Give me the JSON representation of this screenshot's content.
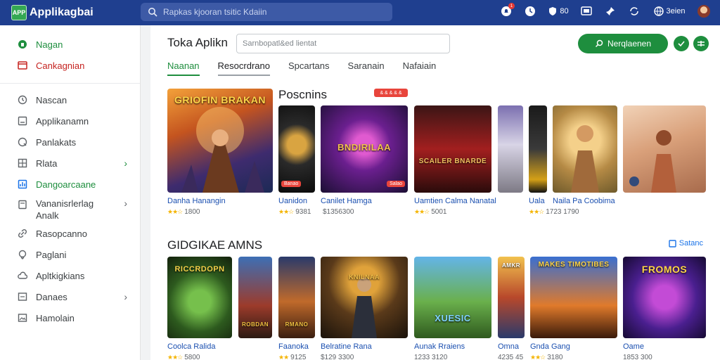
{
  "topbar": {
    "logo_mark": "APP",
    "app_name": "Applikagbai",
    "search_placeholder": "Rapkas kjooran tsitic Kdaiin",
    "notification_count": "1",
    "stat_label": "80",
    "user_label": "3eien",
    "icons": [
      "bell-icon",
      "clock-icon",
      "shield-icon",
      "cast-icon",
      "pin-icon",
      "sync-icon",
      "globe-icon"
    ]
  },
  "sidebar": {
    "top": [
      {
        "label": "Nagan",
        "icon": "home-icon",
        "state": "active"
      },
      {
        "label": "Cankagnian",
        "icon": "library-icon",
        "state": "highlight"
      }
    ],
    "items": [
      {
        "label": "Nascan",
        "icon": "clock-icon"
      },
      {
        "label": "Applikanamn",
        "icon": "app-icon"
      },
      {
        "label": "Panlakats",
        "icon": "search-icon"
      },
      {
        "label": "Rlata",
        "icon": "grid-icon",
        "chevron": "green"
      },
      {
        "label": "Dangoarcaane",
        "icon": "chart-icon",
        "state": "active"
      },
      {
        "label": "Vananisrlerlag Analk",
        "icon": "doc-icon",
        "chevron": "grey"
      },
      {
        "label": "Rasopcanno",
        "icon": "link-icon"
      },
      {
        "label": "Paglani",
        "icon": "pin-icon"
      },
      {
        "label": "Apltkigkians",
        "icon": "cloud-icon"
      },
      {
        "label": "Danaes",
        "icon": "list-icon",
        "chevron": "grey"
      },
      {
        "label": "Hamolain",
        "icon": "image-icon"
      }
    ]
  },
  "main": {
    "title": "Toka Aplikn",
    "search_placeholder": "Sarnbopatl&ed lientat",
    "primary_button": "Nerqlaenen",
    "tabs": [
      "Naanan",
      "Resocrdrano",
      "Spcartans",
      "Saranain",
      "Nafaiain"
    ],
    "section1": {
      "title": "Poscnins",
      "badge": "& & & & &",
      "cards": [
        {
          "thumb": "GRIOFIN BRAKAN",
          "tag": "",
          "name": "Danha Hanangin",
          "stars": "★★☆",
          "meta": "1800"
        },
        {
          "thumb": "",
          "tag": "Banao",
          "name": "Uanidon",
          "stars": "★★☆",
          "meta": "9381"
        },
        {
          "thumb": "BNDIRILAA",
          "tag": "Salao",
          "name": "Canilet Hamga",
          "stars": "",
          "meta": "$1356300"
        },
        {
          "thumb": "SCAILER BNARDE",
          "tag": "",
          "name": "Uamtien Calma Nanatal",
          "stars": "★★☆",
          "meta": "5001"
        },
        {
          "thumb": "",
          "tag": "",
          "name": "Uala",
          "stars": "★★☆",
          "meta": "1723 1790"
        },
        {
          "thumb": "",
          "tag": "",
          "name": "Naila Pa Coobima",
          "stars": "",
          "meta": ""
        },
        {
          "thumb": "",
          "tag": "",
          "name": "",
          "stars": "",
          "meta": ""
        }
      ]
    },
    "section2": {
      "title": "GIDGIKAE AMNS",
      "see_all": "Satanc",
      "cards": [
        {
          "thumb": "RICCRDOPN",
          "name": "Coolca Ralida",
          "stars": "★★☆",
          "meta": "5800"
        },
        {
          "thumb": "ROBDAN",
          "name": "",
          "stars": "",
          "meta": ""
        },
        {
          "thumb": "RMANO",
          "name": "Faanoka",
          "stars": "★★",
          "meta": "9125"
        },
        {
          "thumb": "KNILNAA",
          "name": "Belratine Rana",
          "stars": "",
          "meta": "$129 3300"
        },
        {
          "thumb": "XUESIC",
          "name": "Aunak Rraiens",
          "stars": "",
          "meta": "1233 3120"
        },
        {
          "thumb": "AMKR",
          "name": "Omna",
          "stars": "",
          "meta": "4235 45"
        },
        {
          "thumb": "MAKES TIMOTIBES",
          "name": "Gnda Gang",
          "stars": "★★☆",
          "meta": "3180"
        },
        {
          "thumb": "FROMOS",
          "name": "Oame",
          "stars": "",
          "meta": "1853 300"
        }
      ]
    }
  },
  "colors": {
    "topbar": "#1f3f8f",
    "accent": "#1e8e3e",
    "link": "#1a4fb0",
    "badge": "#e8453c",
    "star": "#f4b400"
  }
}
